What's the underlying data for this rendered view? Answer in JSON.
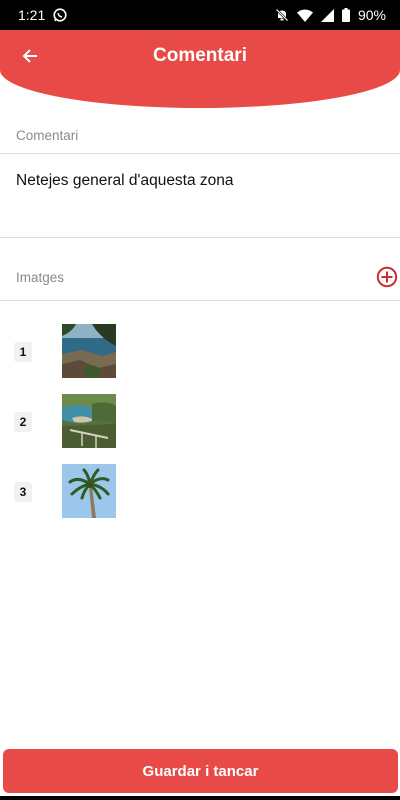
{
  "status_bar": {
    "time": "1:21",
    "battery": "90%",
    "icons": [
      "whatsapp-icon",
      "mute-bell-icon",
      "wifi-icon",
      "signal-icon",
      "battery-icon"
    ]
  },
  "header": {
    "title": "Comentari",
    "back_icon": "arrow-left-icon",
    "color": "#e84b47"
  },
  "comment_section": {
    "label": "Comentari",
    "value": "Netejes general d'aquesta zona"
  },
  "images_section": {
    "label": "Imatges",
    "add_icon": "plus-circle-icon",
    "items": [
      {
        "number": "1",
        "thumbnail": "coastal-pine-photo"
      },
      {
        "number": "2",
        "thumbnail": "beach-cove-photo"
      },
      {
        "number": "3",
        "thumbnail": "palm-tree-photo"
      }
    ]
  },
  "save_button": {
    "label": "Guardar i tancar"
  }
}
